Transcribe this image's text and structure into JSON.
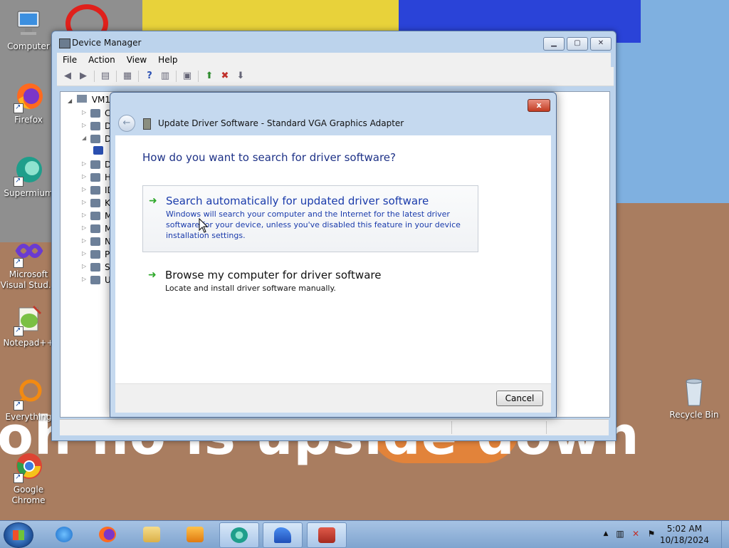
{
  "desktop": {
    "wallpaper_text": "oh no is upside down",
    "icons": [
      {
        "label": "Computer",
        "name": "computer"
      },
      {
        "label": "Firefox",
        "name": "firefox"
      },
      {
        "label": "Supermium",
        "name": "supermium"
      },
      {
        "label": "Microsoft Visual Stud...",
        "name": "visual-studio"
      },
      {
        "label": "Notepad++",
        "name": "notepad-plus-plus"
      },
      {
        "label": "Everything",
        "name": "everything"
      },
      {
        "label": "Google Chrome",
        "name": "google-chrome"
      },
      {
        "label": "Recycle Bin",
        "name": "recycle-bin"
      }
    ]
  },
  "device_manager": {
    "title": "Device Manager",
    "menu": [
      "File",
      "Action",
      "View",
      "Help"
    ],
    "tree": {
      "root_label": "VM1",
      "items": [
        "C",
        "D",
        "D",
        "",
        "D",
        "H",
        "ID",
        "K",
        "M",
        "M",
        "N",
        "P",
        "S",
        "U"
      ]
    }
  },
  "dialog": {
    "title": "Update Driver Software - Standard VGA Graphics Adapter",
    "heading": "How do you want to search for driver software?",
    "options": [
      {
        "title": "Search automatically for updated driver software",
        "description": "Windows will search your computer and the Internet for the latest driver software for your device, unless you've disabled this feature in your device installation settings."
      },
      {
        "title": "Browse my computer for driver software",
        "description": "Locate and install driver software manually."
      }
    ],
    "cancel_label": "Cancel",
    "close_label": "x"
  },
  "taskbar": {
    "time": "5:02 AM",
    "date": "10/18/2024",
    "apps": [
      "internet-explorer",
      "firefox",
      "file-explorer",
      "media-player",
      "supermium",
      "app-blue",
      "device-manager"
    ]
  },
  "colors": {
    "link_blue": "#1a3bab",
    "heading_blue": "#1e3287",
    "arrow_green": "#2ea82a"
  }
}
